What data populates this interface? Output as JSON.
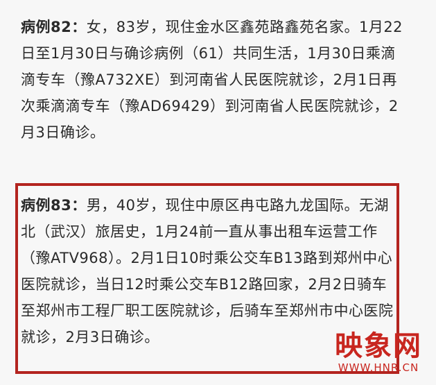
{
  "case82": {
    "label": "病例82：",
    "text": "女，83岁，现住金水区鑫苑路鑫苑名家。1月22日至1月30日与确诊病例（61）共同生活，1月30日乘滴滴专车（豫A732XE）到河南省人民医院就诊，2月1日再次乘滴滴专车（豫AD69429）到河南省人民医院就诊，2月3日确诊。"
  },
  "case83": {
    "label": "病例83：",
    "text": "男，40岁，现住中原区冉屯路九龙国际。无湖北（武汉）旅居史，1月24前一直从事出租车运营工作（豫ATV968）。2月1日10时乘公交车B13路到郑州中心医院就诊，当日12时乘公交车B12路回家，2月2日骑车至郑州市工程厂职工医院就诊，后骑车至郑州市中心医院就诊，2月3日确诊。"
  },
  "watermark": {
    "logo": "映象网",
    "url": "WWW.HNR.CN"
  },
  "colors": {
    "highlight_border": "#b3241f",
    "watermark": "#c8261f"
  }
}
